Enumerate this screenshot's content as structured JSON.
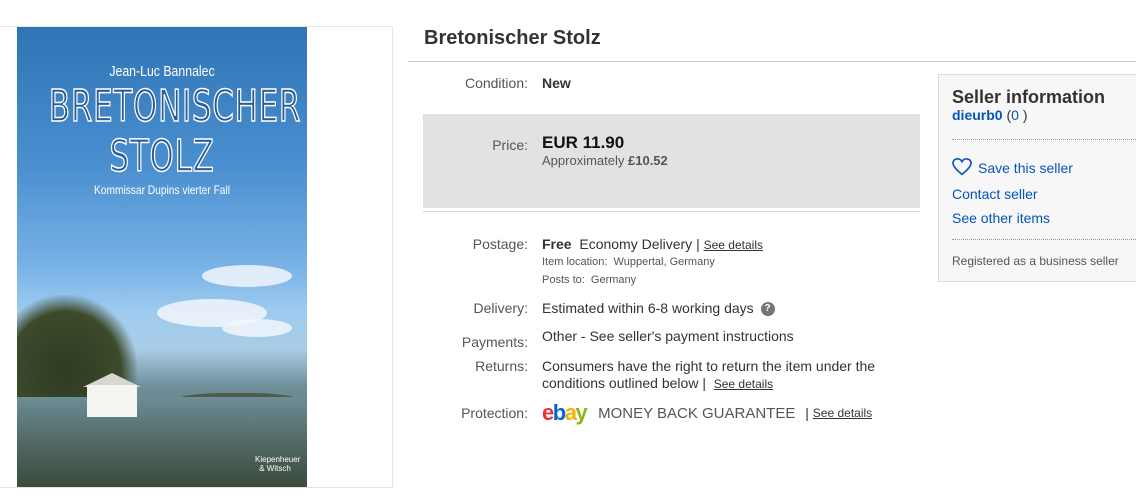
{
  "image": {
    "author": "Jean-Luc Bannalec",
    "title_line1": "BRETONISCHER",
    "title_line2": "STOLZ",
    "subtitle": "Kommissar Dupins vierter Fall",
    "publisher": "Kiepenheuer & Witsch"
  },
  "item": {
    "title": "Bretonischer Stolz"
  },
  "condition": {
    "label": "Condition:",
    "value": "New"
  },
  "price": {
    "label": "Price:",
    "value": "EUR 11.90",
    "approx_prefix": "Approximately",
    "approx_value": "£10.52"
  },
  "postage": {
    "label": "Postage:",
    "value": "Free",
    "service": "Economy Delivery",
    "separator": "|",
    "details_link": "See details",
    "location_label": "Item location:",
    "location": "Wuppertal, Germany",
    "posts_to_label": "Posts to:",
    "posts_to": "Germany"
  },
  "delivery": {
    "label": "Delivery:",
    "value": "Estimated within 6-8 working days",
    "help": "?"
  },
  "payments": {
    "label": "Payments:",
    "value": "Other - See seller's payment instructions"
  },
  "returns": {
    "label": "Returns:",
    "line1": "Consumers have the right to return the item under the",
    "line2": "conditions outlined below |",
    "details_link": "See details"
  },
  "protection": {
    "label": "Protection:",
    "logo": "ebay",
    "guarantee": "MONEY BACK GUARANTEE",
    "separator": "|",
    "details_link": "See details"
  },
  "seller": {
    "heading": "Seller information",
    "username": "dieurb0",
    "feedback_open": "(",
    "feedback": "0",
    "feedback_close": ")",
    "save": "Save this seller",
    "contact": "Contact seller",
    "other_items": "See other items",
    "note": "Registered as a business seller"
  },
  "colors": {
    "link": "#0654ba",
    "price_box": "#e2e2e2",
    "ebay_e": "#e53238",
    "ebay_b": "#0064d2",
    "ebay_a": "#f5af02",
    "ebay_y": "#86b817"
  }
}
